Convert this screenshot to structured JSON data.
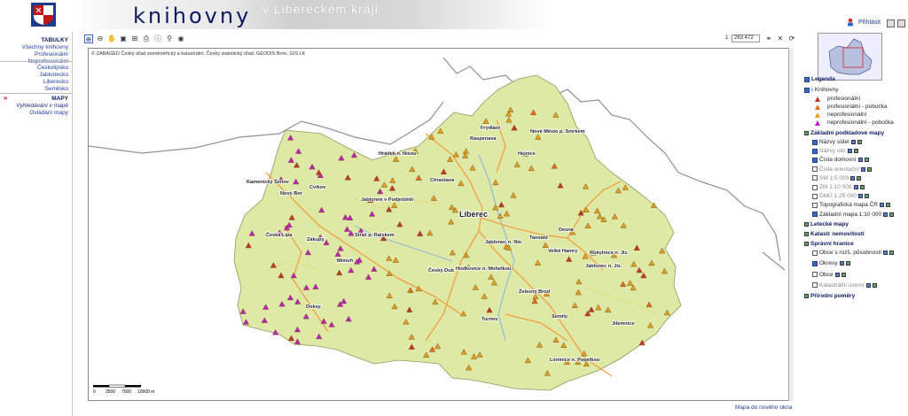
{
  "header": {
    "title": "knihovny",
    "subtitle": "v Libereckém kraji",
    "login_label": "Přihlásit"
  },
  "nav": {
    "tabulky": {
      "head": "TABULKY",
      "items": [
        "Všechny knihovny",
        "Profesionální",
        "Neprofesionální"
      ]
    },
    "okresy": {
      "items": [
        "Českolipsko",
        "Jablonecko",
        "Liberecko",
        "Semilsko"
      ]
    },
    "mapy": {
      "head": "MAPY",
      "items": [
        "Vyhledávání v mapě",
        "Ovládání mapy"
      ]
    },
    "marker": "»"
  },
  "toolbar": {
    "scale_prefix": "1 :",
    "scale_value": "263 472"
  },
  "map": {
    "copyright": "© ZABAGED Český úřad zeměměřický a katastrální, Český statistický úřad, GEODIS Brno, GIS LK",
    "scale_labels": [
      "0",
      "3500",
      "7000",
      "10500 m"
    ],
    "new_window": "Mapa do nového okna",
    "towns": [
      {
        "name": "Frýdlant"
      },
      {
        "name": "Raspenava"
      },
      {
        "name": "Nové Město p. Smrkem"
      },
      {
        "name": "Hejnice"
      },
      {
        "name": "Hrádek n. Nisou"
      },
      {
        "name": "Chrastava"
      },
      {
        "name": "Kamenický Šenov"
      },
      {
        "name": "Cvikov"
      },
      {
        "name": "Nový Bor"
      },
      {
        "name": "Jablonné v Podještědí"
      },
      {
        "name": "Liberec"
      },
      {
        "name": "Česká Lípa"
      },
      {
        "name": "Zákupy"
      },
      {
        "name": "Stráž p. Ralskem"
      },
      {
        "name": "Mimoň"
      },
      {
        "name": "Jablonec n. Nis."
      },
      {
        "name": "Desná"
      },
      {
        "name": "Tanvald"
      },
      {
        "name": "Velké Hamry"
      },
      {
        "name": "Rokytnice n. Jiz."
      },
      {
        "name": "Jablonec n. Jiz."
      },
      {
        "name": "Český Dub"
      },
      {
        "name": "Hodkovice n. Mohelkou"
      },
      {
        "name": "Železný Brod"
      },
      {
        "name": "Doksy"
      },
      {
        "name": "Turnov"
      },
      {
        "name": "Semily"
      },
      {
        "name": "Jilemnice"
      },
      {
        "name": "Lomnice n. Popelkou"
      }
    ]
  },
  "legend": {
    "title": "Legenda",
    "knihovny": "Knihovny",
    "types": [
      {
        "label": "profesionální",
        "color": "#c0392b"
      },
      {
        "label": "profesionální - pobočka",
        "color": "#e07020"
      },
      {
        "label": "neprofesionální",
        "color": "#e0a020"
      },
      {
        "label": "neprofesionální - pobočka",
        "color": "#c020c0"
      }
    ],
    "zakladni": "Základní podkladové mapy",
    "base_layers": [
      {
        "label": "Názvy sídel",
        "on": true,
        "dim": false
      },
      {
        "label": "Názvy ulic",
        "on": true,
        "dim": true
      },
      {
        "label": "Čísla domovní",
        "on": true,
        "dim": false
      },
      {
        "label": "Čísla orientační",
        "on": false,
        "dim": true
      },
      {
        "label": "SM 1:5 000",
        "on": false,
        "dim": true
      },
      {
        "label": "ZM 1:10 000",
        "on": false,
        "dim": true
      },
      {
        "label": "DMÚ 1:25 000",
        "on": false,
        "dim": true
      },
      {
        "label": "Topografická mapa ČR",
        "on": false,
        "dim": false
      },
      {
        "label": "Základní mapa 1:10 000",
        "on": true,
        "dim": false
      }
    ],
    "letecke": "Letecké mapy",
    "katastr": "Katastr nemovitostí",
    "spravni": "Správní hranice",
    "admin_layers": [
      {
        "label": "Obce s rozš. působností",
        "on": false,
        "dim": false
      },
      {
        "label": "Okresy",
        "on": true,
        "dim": false
      },
      {
        "label": "Obce",
        "on": false,
        "dim": false
      },
      {
        "label": "Katastrální území",
        "on": false,
        "dim": true
      }
    ],
    "prirodni": "Přírodní poměry"
  },
  "colors": {
    "map_green": "#dfe9a6",
    "road_orange": "#f0a040",
    "water": "#7fb0e0",
    "border": "#9a8aa0"
  }
}
